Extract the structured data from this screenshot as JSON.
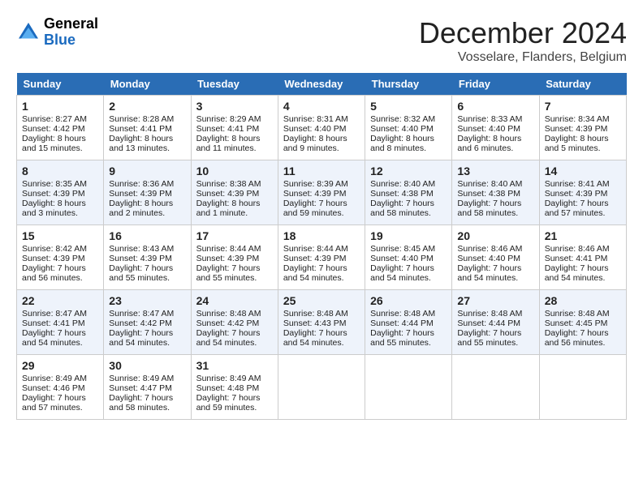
{
  "header": {
    "logo_general": "General",
    "logo_blue": "Blue",
    "title": "December 2024",
    "subtitle": "Vosselare, Flanders, Belgium"
  },
  "weekdays": [
    "Sunday",
    "Monday",
    "Tuesday",
    "Wednesday",
    "Thursday",
    "Friday",
    "Saturday"
  ],
  "weeks": [
    [
      {
        "day": "1",
        "lines": [
          "Sunrise: 8:27 AM",
          "Sunset: 4:42 PM",
          "Daylight: 8 hours",
          "and 15 minutes."
        ]
      },
      {
        "day": "2",
        "lines": [
          "Sunrise: 8:28 AM",
          "Sunset: 4:41 PM",
          "Daylight: 8 hours",
          "and 13 minutes."
        ]
      },
      {
        "day": "3",
        "lines": [
          "Sunrise: 8:29 AM",
          "Sunset: 4:41 PM",
          "Daylight: 8 hours",
          "and 11 minutes."
        ]
      },
      {
        "day": "4",
        "lines": [
          "Sunrise: 8:31 AM",
          "Sunset: 4:40 PM",
          "Daylight: 8 hours",
          "and 9 minutes."
        ]
      },
      {
        "day": "5",
        "lines": [
          "Sunrise: 8:32 AM",
          "Sunset: 4:40 PM",
          "Daylight: 8 hours",
          "and 8 minutes."
        ]
      },
      {
        "day": "6",
        "lines": [
          "Sunrise: 8:33 AM",
          "Sunset: 4:40 PM",
          "Daylight: 8 hours",
          "and 6 minutes."
        ]
      },
      {
        "day": "7",
        "lines": [
          "Sunrise: 8:34 AM",
          "Sunset: 4:39 PM",
          "Daylight: 8 hours",
          "and 5 minutes."
        ]
      }
    ],
    [
      {
        "day": "8",
        "lines": [
          "Sunrise: 8:35 AM",
          "Sunset: 4:39 PM",
          "Daylight: 8 hours",
          "and 3 minutes."
        ]
      },
      {
        "day": "9",
        "lines": [
          "Sunrise: 8:36 AM",
          "Sunset: 4:39 PM",
          "Daylight: 8 hours",
          "and 2 minutes."
        ]
      },
      {
        "day": "10",
        "lines": [
          "Sunrise: 8:38 AM",
          "Sunset: 4:39 PM",
          "Daylight: 8 hours",
          "and 1 minute."
        ]
      },
      {
        "day": "11",
        "lines": [
          "Sunrise: 8:39 AM",
          "Sunset: 4:39 PM",
          "Daylight: 7 hours",
          "and 59 minutes."
        ]
      },
      {
        "day": "12",
        "lines": [
          "Sunrise: 8:40 AM",
          "Sunset: 4:38 PM",
          "Daylight: 7 hours",
          "and 58 minutes."
        ]
      },
      {
        "day": "13",
        "lines": [
          "Sunrise: 8:40 AM",
          "Sunset: 4:38 PM",
          "Daylight: 7 hours",
          "and 58 minutes."
        ]
      },
      {
        "day": "14",
        "lines": [
          "Sunrise: 8:41 AM",
          "Sunset: 4:39 PM",
          "Daylight: 7 hours",
          "and 57 minutes."
        ]
      }
    ],
    [
      {
        "day": "15",
        "lines": [
          "Sunrise: 8:42 AM",
          "Sunset: 4:39 PM",
          "Daylight: 7 hours",
          "and 56 minutes."
        ]
      },
      {
        "day": "16",
        "lines": [
          "Sunrise: 8:43 AM",
          "Sunset: 4:39 PM",
          "Daylight: 7 hours",
          "and 55 minutes."
        ]
      },
      {
        "day": "17",
        "lines": [
          "Sunrise: 8:44 AM",
          "Sunset: 4:39 PM",
          "Daylight: 7 hours",
          "and 55 minutes."
        ]
      },
      {
        "day": "18",
        "lines": [
          "Sunrise: 8:44 AM",
          "Sunset: 4:39 PM",
          "Daylight: 7 hours",
          "and 54 minutes."
        ]
      },
      {
        "day": "19",
        "lines": [
          "Sunrise: 8:45 AM",
          "Sunset: 4:40 PM",
          "Daylight: 7 hours",
          "and 54 minutes."
        ]
      },
      {
        "day": "20",
        "lines": [
          "Sunrise: 8:46 AM",
          "Sunset: 4:40 PM",
          "Daylight: 7 hours",
          "and 54 minutes."
        ]
      },
      {
        "day": "21",
        "lines": [
          "Sunrise: 8:46 AM",
          "Sunset: 4:41 PM",
          "Daylight: 7 hours",
          "and 54 minutes."
        ]
      }
    ],
    [
      {
        "day": "22",
        "lines": [
          "Sunrise: 8:47 AM",
          "Sunset: 4:41 PM",
          "Daylight: 7 hours",
          "and 54 minutes."
        ]
      },
      {
        "day": "23",
        "lines": [
          "Sunrise: 8:47 AM",
          "Sunset: 4:42 PM",
          "Daylight: 7 hours",
          "and 54 minutes."
        ]
      },
      {
        "day": "24",
        "lines": [
          "Sunrise: 8:48 AM",
          "Sunset: 4:42 PM",
          "Daylight: 7 hours",
          "and 54 minutes."
        ]
      },
      {
        "day": "25",
        "lines": [
          "Sunrise: 8:48 AM",
          "Sunset: 4:43 PM",
          "Daylight: 7 hours",
          "and 54 minutes."
        ]
      },
      {
        "day": "26",
        "lines": [
          "Sunrise: 8:48 AM",
          "Sunset: 4:44 PM",
          "Daylight: 7 hours",
          "and 55 minutes."
        ]
      },
      {
        "day": "27",
        "lines": [
          "Sunrise: 8:48 AM",
          "Sunset: 4:44 PM",
          "Daylight: 7 hours",
          "and 55 minutes."
        ]
      },
      {
        "day": "28",
        "lines": [
          "Sunrise: 8:48 AM",
          "Sunset: 4:45 PM",
          "Daylight: 7 hours",
          "and 56 minutes."
        ]
      }
    ],
    [
      {
        "day": "29",
        "lines": [
          "Sunrise: 8:49 AM",
          "Sunset: 4:46 PM",
          "Daylight: 7 hours",
          "and 57 minutes."
        ]
      },
      {
        "day": "30",
        "lines": [
          "Sunrise: 8:49 AM",
          "Sunset: 4:47 PM",
          "Daylight: 7 hours",
          "and 58 minutes."
        ]
      },
      {
        "day": "31",
        "lines": [
          "Sunrise: 8:49 AM",
          "Sunset: 4:48 PM",
          "Daylight: 7 hours",
          "and 59 minutes."
        ]
      },
      null,
      null,
      null,
      null
    ]
  ]
}
